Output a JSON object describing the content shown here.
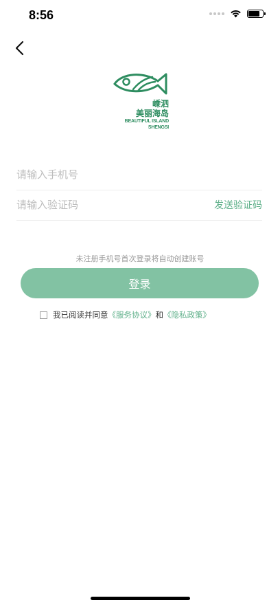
{
  "status_bar": {
    "time": "8:56",
    "battery_level": 0.85
  },
  "icons": {
    "back": "chevron-left-icon",
    "wifi": "wifi-icon",
    "battery": "battery-icon",
    "signal": "signal-dots-icon"
  },
  "logo": {
    "cn_line1": "嵊泗",
    "cn_line2": "美丽海岛",
    "en_line1": "BEAUTIFUL ISLAND",
    "en_line2": "SHENGSI"
  },
  "form": {
    "phone_placeholder": "请输入手机号",
    "code_placeholder": "请输入验证码",
    "send_code_label": "发送验证码"
  },
  "hint_text": "未注册手机号首次登录将自动创建账号",
  "login_label": "登录",
  "agreement": {
    "prefix": "我已阅读并同意",
    "service_link": "《服务协议》",
    "conjunction": "和",
    "privacy_link": "《隐私政策》"
  },
  "colors": {
    "brand": "#2e8d60",
    "accent": "#5fb08a",
    "button": "#82c2a3"
  }
}
